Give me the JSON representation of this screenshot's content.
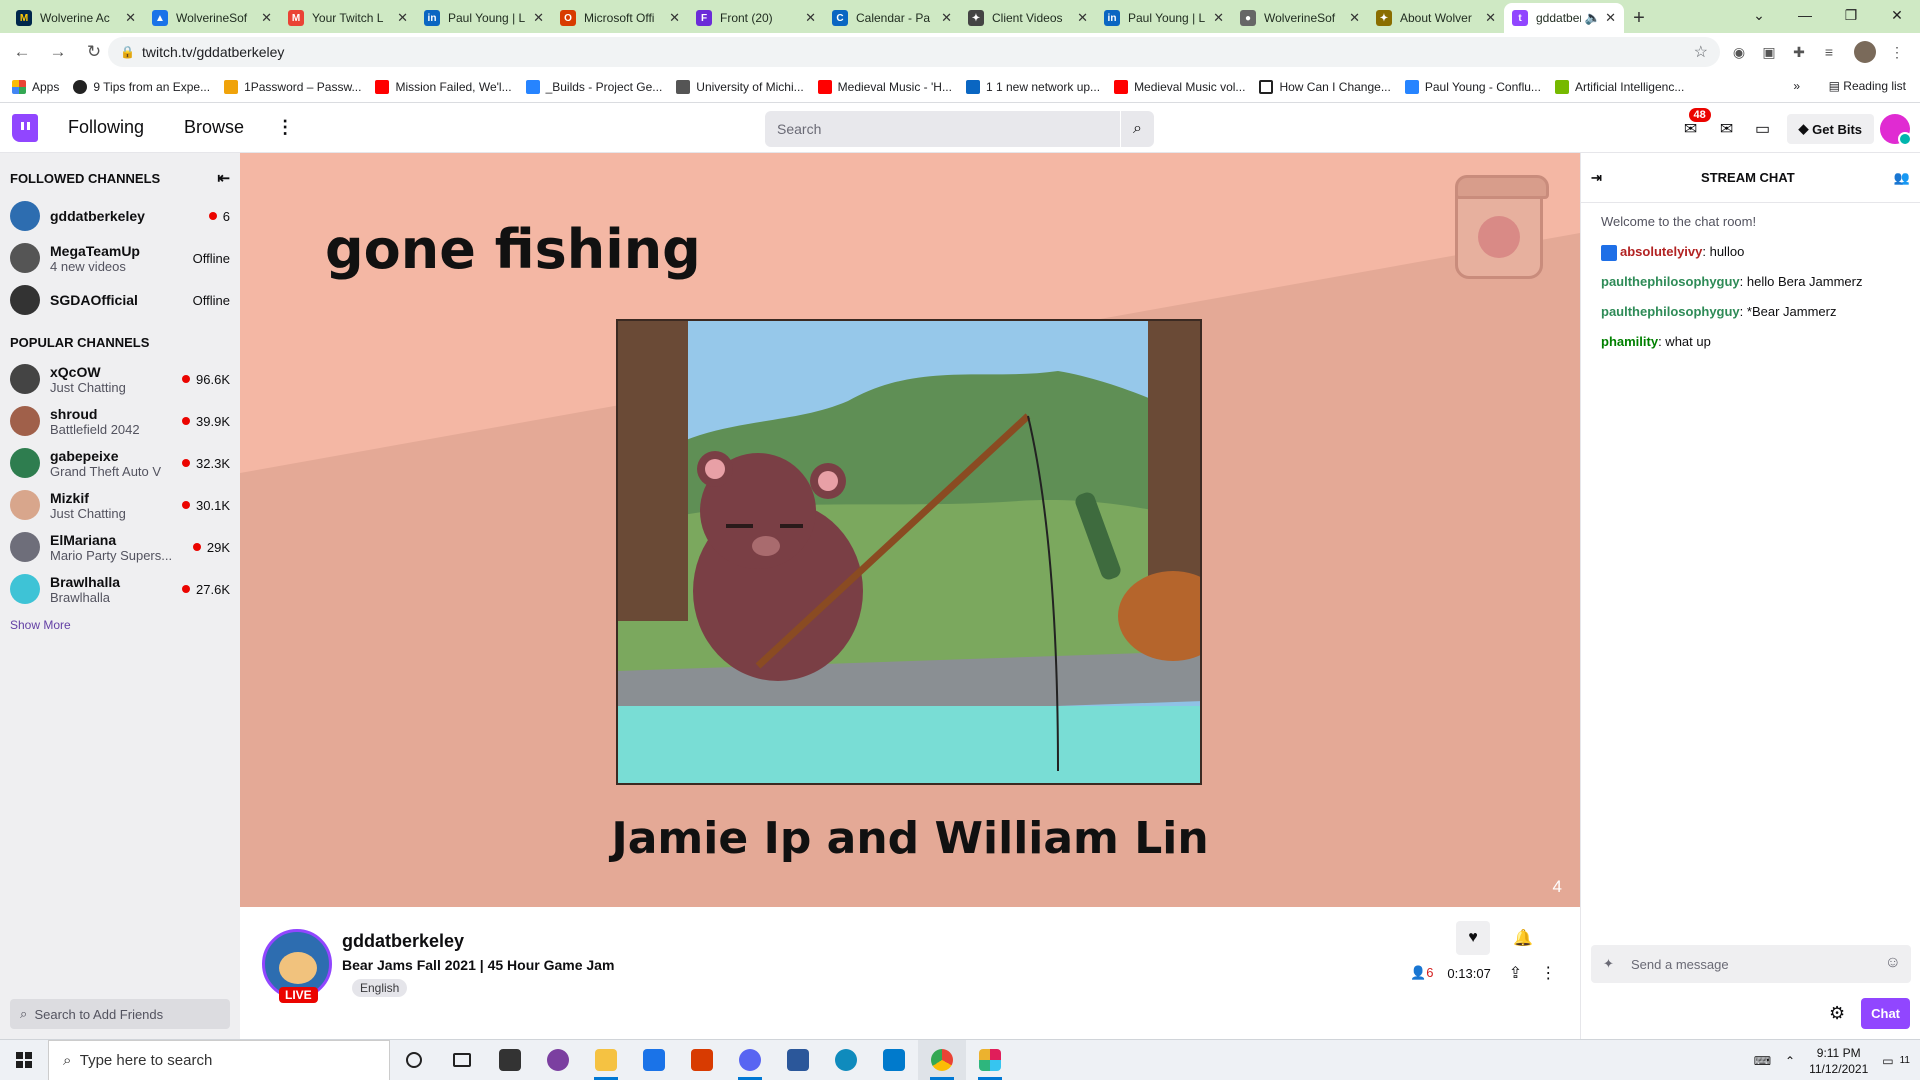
{
  "browser": {
    "tabs": [
      {
        "title": "Wolverine Ac",
        "color": "#00274c",
        "letter": "M"
      },
      {
        "title": "WolverineSof",
        "color": "#1a73e8",
        "letter": "▲"
      },
      {
        "title": "Your Twitch L",
        "color": "#ea4335",
        "letter": "M"
      },
      {
        "title": "Paul Young | L",
        "color": "#0a66c2",
        "letter": "in"
      },
      {
        "title": "Microsoft Offi",
        "color": "#d83b01",
        "letter": "O"
      },
      {
        "title": "Front (20)",
        "color": "#6b2bd8",
        "letter": "F"
      },
      {
        "title": "Calendar - Pa",
        "color": "#0a66c2",
        "letter": "C"
      },
      {
        "title": "Client Videos",
        "color": "#444444",
        "letter": "✦"
      },
      {
        "title": "Paul Young | L",
        "color": "#0a66c2",
        "letter": "in"
      },
      {
        "title": "WolverineSof",
        "color": "#666666",
        "letter": "●"
      },
      {
        "title": "About Wolver",
        "color": "#8a6d00",
        "letter": "✦"
      },
      {
        "title": "gddatber",
        "color": "#9146ff",
        "letter": "t"
      }
    ],
    "url": "twitch.tv/gddatberkeley",
    "bookmarks": [
      {
        "label": "Apps",
        "color": "#ea4335"
      },
      {
        "label": "9 Tips from an Expe...",
        "color": "#222222"
      },
      {
        "label": "1Password – Passw...",
        "color": "#f0a30a"
      },
      {
        "label": "Mission Failed, We'l...",
        "color": "#ff0000"
      },
      {
        "label": "_Builds - Project Ge...",
        "color": "#2684ff"
      },
      {
        "label": "University of Michi...",
        "color": "#555555"
      },
      {
        "label": "Medieval Music - 'H...",
        "color": "#ff0000"
      },
      {
        "label": "1 1 new network up...",
        "color": "#0a66c2"
      },
      {
        "label": "Medieval Music vol...",
        "color": "#ff0000"
      },
      {
        "label": "How Can I Change...",
        "color": "#222222"
      },
      {
        "label": "Paul Young - Conflu...",
        "color": "#2684ff"
      },
      {
        "label": "Artificial Intelligenc...",
        "color": "#76b900"
      }
    ],
    "reading_list": "Reading list"
  },
  "twitch": {
    "nav": {
      "following": "Following",
      "browse": "Browse"
    },
    "search_placeholder": "Search",
    "notifications_count": "48",
    "get_bits": "Get Bits",
    "sidebar": {
      "followed_header": "FOLLOWED CHANNELS",
      "followed": [
        {
          "name": "gddatberkeley",
          "sub": "",
          "stat": "6",
          "live": true,
          "color": "#2d6db0"
        },
        {
          "name": "MegaTeamUp",
          "sub": "4 new videos",
          "stat": "Offline",
          "live": false,
          "color": "#555555"
        },
        {
          "name": "SGDAOfficial",
          "sub": "",
          "stat": "Offline",
          "live": false,
          "color": "#333333"
        }
      ],
      "popular_header": "POPULAR CHANNELS",
      "popular": [
        {
          "name": "xQcOW",
          "sub": "Just Chatting",
          "stat": "96.6K",
          "color": "#444444"
        },
        {
          "name": "shroud",
          "sub": "Battlefield 2042",
          "stat": "39.9K",
          "color": "#a0604a"
        },
        {
          "name": "gabepeixe",
          "sub": "Grand Theft Auto V",
          "stat": "32.3K",
          "color": "#2e7d4f"
        },
        {
          "name": "Mizkif",
          "sub": "Just Chatting",
          "stat": "30.1K",
          "color": "#d8a68c"
        },
        {
          "name": "ElMariana",
          "sub": "Mario Party Supers...",
          "stat": "29K",
          "color": "#6e6e7a"
        },
        {
          "name": "Brawlhalla",
          "sub": "Brawlhalla",
          "stat": "27.6K",
          "color": "#3ec3d6"
        }
      ],
      "show_more": "Show More",
      "friends_search": "Search to Add Friends"
    },
    "stream": {
      "overlay_title": "gone fishing",
      "overlay_credits": "Jamie Ip and William Lin",
      "corner_number": "4",
      "channel": "gddatberkeley",
      "title": "Bear Jams Fall 2021 | 45 Hour Game Jam",
      "tag": "English",
      "live_badge": "LIVE",
      "viewers": "6",
      "uptime": "0:13:07"
    },
    "chat": {
      "header": "STREAM CHAT",
      "welcome": "Welcome to the chat room!",
      "messages": [
        {
          "user": "absolutelyivy",
          "text": ": hulloo",
          "color": "#b22222",
          "mod": true
        },
        {
          "user": "paulthephilosophyguy",
          "text": ": hello Bera Jammerz",
          "color": "#2e8b57",
          "mod": false
        },
        {
          "user": "paulthephilosophyguy",
          "text": ": *Bear Jammerz",
          "color": "#2e8b57",
          "mod": false
        },
        {
          "user": "phamility",
          "text": ": what up",
          "color": "#008000",
          "mod": false
        }
      ],
      "placeholder": "Send a message",
      "chat_button": "Chat"
    }
  },
  "taskbar": {
    "search_placeholder": "Type here to search",
    "time": "9:11 PM",
    "date": "11/12/2021",
    "notif_count": "11"
  }
}
